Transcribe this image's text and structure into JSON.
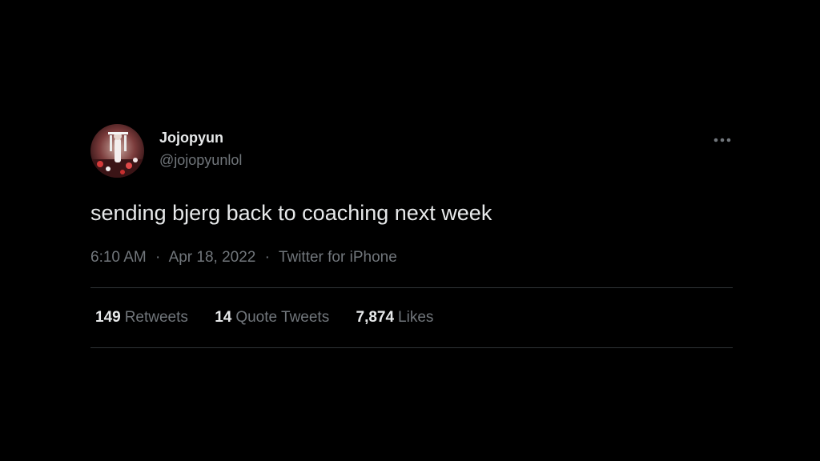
{
  "tweet": {
    "author": {
      "display_name": "Jojopyun",
      "handle": "@jojopyunlol"
    },
    "text": "sending bjerg back to coaching next week",
    "meta": {
      "time": "6:10 AM",
      "date": "Apr 18, 2022",
      "source": "Twitter for iPhone",
      "separator": "·"
    },
    "stats": [
      {
        "count": "149",
        "label": "Retweets"
      },
      {
        "count": "14",
        "label": "Quote Tweets"
      },
      {
        "count": "7,874",
        "label": "Likes"
      }
    ]
  },
  "icons": {
    "more": "more-horizontal-icon"
  },
  "colors": {
    "background": "#000000",
    "primary_text": "#e7e9ea",
    "secondary_text": "#71767b",
    "divider": "#2f3336"
  }
}
